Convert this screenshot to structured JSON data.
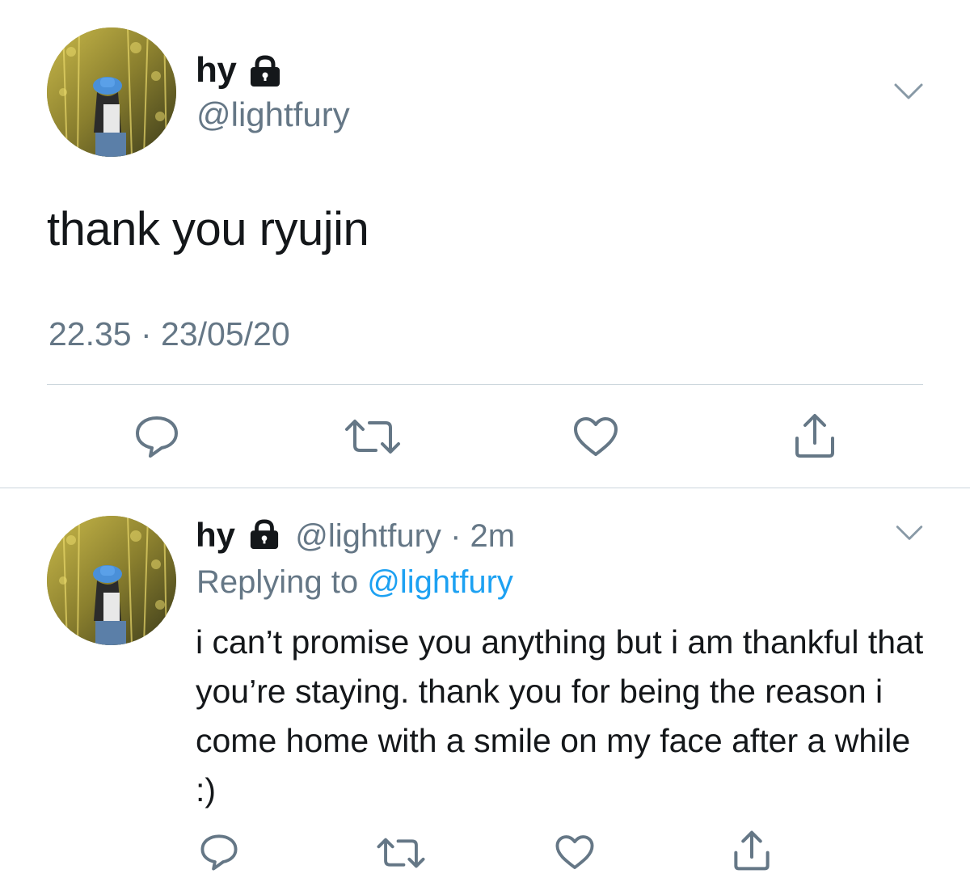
{
  "main_tweet": {
    "display_name": "hy",
    "handle": "@lightfury",
    "text": "thank you ryujin",
    "timestamp": "22.35 · 23/05/20",
    "icons": {
      "lock": "lock-icon",
      "menu": "chevron-down-icon",
      "reply": "reply-icon",
      "retweet": "retweet-icon",
      "like": "heart-icon",
      "share": "share-icon"
    }
  },
  "reply_tweet": {
    "display_name": "hy",
    "handle": "@lightfury",
    "separator": "·",
    "time_ago": "2m",
    "replying_to_label": "Replying to",
    "replying_to_handle": "@lightfury",
    "text": "i can’t promise you anything but i am thankful that you’re staying. thank you for being the reason i come home with a smile on my face after a while :)"
  },
  "colors": {
    "text_primary": "#14171a",
    "text_secondary": "#657786",
    "link": "#1da1f2",
    "divider": "#ccd6dd",
    "icon": "#657786"
  }
}
